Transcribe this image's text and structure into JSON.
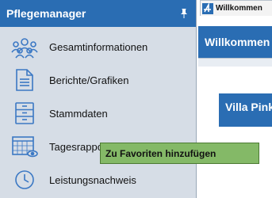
{
  "sidebar": {
    "title": "Pflegemanager",
    "items": [
      {
        "label": "Gesamtinformationen",
        "icon": "users-group-icon"
      },
      {
        "label": "Berichte/Grafiken",
        "icon": "document-icon"
      },
      {
        "label": "Stammdaten",
        "icon": "cabinet-icon"
      },
      {
        "label": "Tagesrapport",
        "icon": "calendar-view-icon"
      },
      {
        "label": "Leistungsnachweis",
        "icon": "clock-icon"
      }
    ]
  },
  "tab": {
    "label": "Willkommen"
  },
  "main": {
    "welcome_title": "Willkommen",
    "card_title": "Villa Pink"
  },
  "tooltip": {
    "text": "Zu Favoriten hinzufügen"
  },
  "colors": {
    "accent": "#2a6db3",
    "sidebar_bg": "#d6dde6",
    "tooltip_bg": "#84b967"
  }
}
